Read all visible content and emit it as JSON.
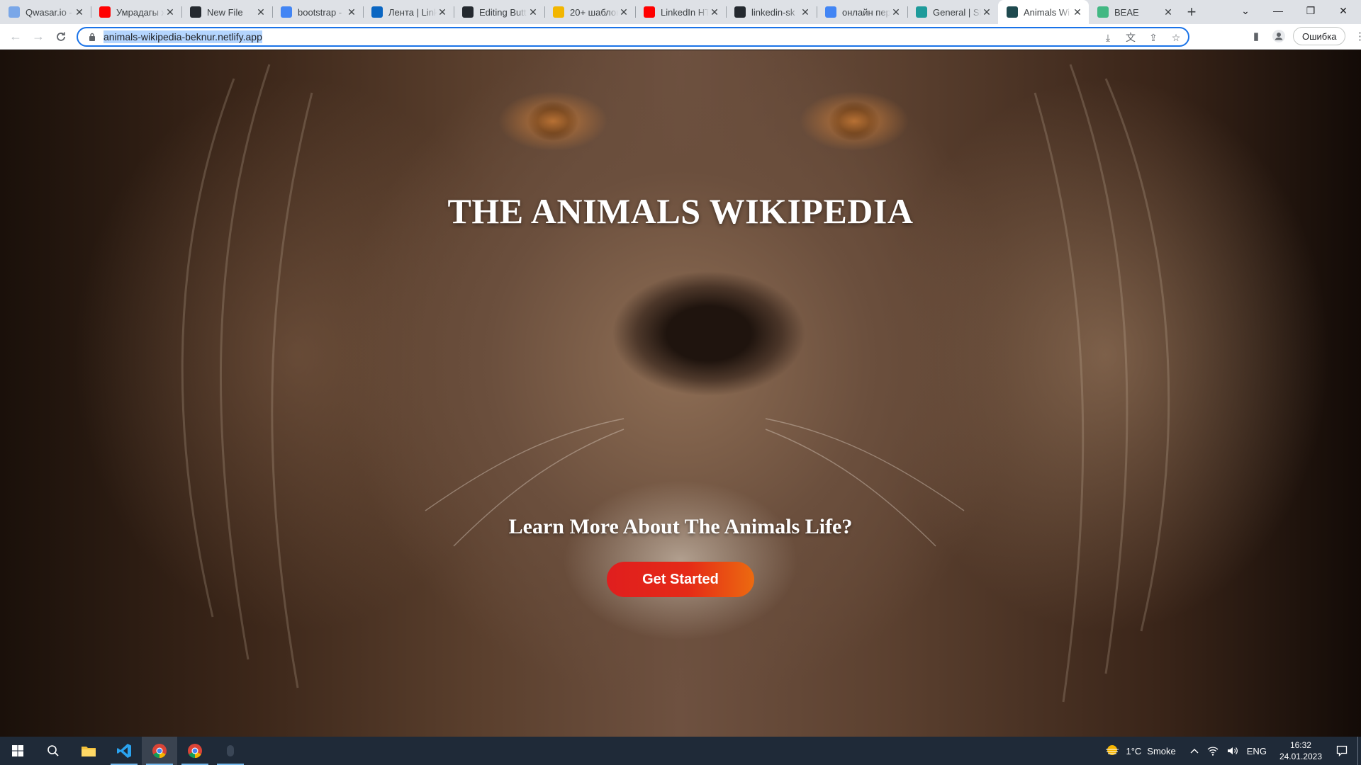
{
  "browser": {
    "tabs": [
      {
        "title": "Qwasar.io -",
        "icon": "qwasar-icon",
        "color": "#7aa7e8"
      },
      {
        "title": "Умрадагы ж",
        "icon": "youtube-icon",
        "color": "#ff0000"
      },
      {
        "title": "New File",
        "icon": "github-icon",
        "color": "#24292f"
      },
      {
        "title": "bootstrap -",
        "icon": "google-icon",
        "color": "#4285f4"
      },
      {
        "title": "Лента | Link",
        "icon": "linkedin-icon",
        "color": "#0a66c2"
      },
      {
        "title": "Editing Butt",
        "icon": "github-icon",
        "color": "#24292f"
      },
      {
        "title": "20+ шаблон",
        "icon": "page-icon",
        "color": "#f2b600"
      },
      {
        "title": "LinkedIn HT",
        "icon": "youtube-icon",
        "color": "#ff0000"
      },
      {
        "title": "linkedin-sk",
        "icon": "github-icon",
        "color": "#24292f"
      },
      {
        "title": "онлайн пер",
        "icon": "google-icon",
        "color": "#4285f4"
      },
      {
        "title": "General | Sl",
        "icon": "slack-icon",
        "color": "#1e9b9b"
      },
      {
        "title": "Animals Wi",
        "icon": "netlify-icon",
        "color": "#1f4a4f"
      },
      {
        "title": "BEAE",
        "icon": "vue-icon",
        "color": "#42b883"
      }
    ],
    "active_tab_index": 11,
    "new_tab_symbol": "+",
    "url": "animals-wikipedia-beknur.netlify.app",
    "profile_label": "Ошибка"
  },
  "hero": {
    "title": "THE ANIMALS WIKIPEDIA",
    "subtitle": "Learn More About The Animals Life?",
    "cta_label": "Get Started"
  },
  "taskbar": {
    "weather_temp": "1°C",
    "weather_text": "Smoke",
    "language": "ENG",
    "time": "16:32",
    "date": "24.01.2023"
  }
}
